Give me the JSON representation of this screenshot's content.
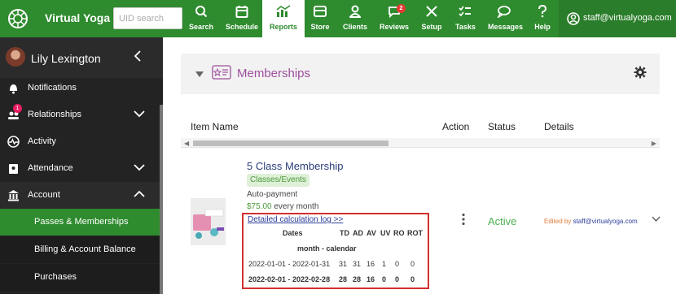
{
  "app": {
    "brand": "Virtual Yoga",
    "search_placeholder": "UID search",
    "user_email": "staff@virtualyoga.com"
  },
  "nav": [
    {
      "label": "Search",
      "icon": "search-icon"
    },
    {
      "label": "Schedule",
      "icon": "calendar-icon"
    },
    {
      "label": "Reports",
      "icon": "chart-icon",
      "active": true
    },
    {
      "label": "Store",
      "icon": "store-icon"
    },
    {
      "label": "Clients",
      "icon": "person-icon"
    },
    {
      "label": "Reviews",
      "icon": "chat-icon",
      "badge": "2"
    },
    {
      "label": "Setup",
      "icon": "tools-icon"
    },
    {
      "label": "Tasks",
      "icon": "checklist-icon"
    },
    {
      "label": "Messages",
      "icon": "messages-icon"
    },
    {
      "label": "Help",
      "icon": "question-icon"
    }
  ],
  "sidebar": {
    "profile_name": "Lily Lexington",
    "items": [
      {
        "label": "Notifications",
        "icon": "bell-icon"
      },
      {
        "label": "Relationships",
        "icon": "relationships-icon",
        "badge": "1"
      },
      {
        "label": "Activity",
        "icon": "activity-icon"
      },
      {
        "label": "Attendance",
        "icon": "attendance-icon"
      },
      {
        "label": "Account",
        "icon": "bank-icon"
      },
      {
        "label": "Passes & Memberships"
      },
      {
        "label": "Billing & Account Balance"
      },
      {
        "label": "Purchases"
      }
    ]
  },
  "panel": {
    "title": "Memberships"
  },
  "table": {
    "headers": {
      "item": "Item Name",
      "action": "Action",
      "status": "Status",
      "details": "Details"
    },
    "row": {
      "title": "5 Class Membership",
      "tag": "Classes/Events",
      "payment_type": "Auto-payment",
      "price": "$75.00",
      "price_suffix": " every month",
      "status": "Active",
      "details_prefix": "Edited by ",
      "details_user": "staff@virtualyoga.com",
      "calc": {
        "link": "Detailed calculation log >>",
        "col_dates": "Dates",
        "cols": [
          "TD",
          "AD",
          "AV",
          "UV",
          "RO",
          "ROT"
        ],
        "period": "month - calendar",
        "rows": [
          {
            "dates": "2022-01-01 - 2022-01-31",
            "vals": [
              "31",
              "31",
              "16",
              "1",
              "0",
              "0"
            ],
            "bold": false
          },
          {
            "dates": "2022-02-01 - 2022-02-28",
            "vals": [
              "28",
              "28",
              "16",
              "0",
              "0",
              "0"
            ],
            "bold": true
          }
        ]
      }
    }
  },
  "colors": {
    "brand_green": "#2e8b2e",
    "active_green": "#4caf50",
    "panel_title": "#9c4f9c",
    "highlight_border": "#d32f2f"
  }
}
